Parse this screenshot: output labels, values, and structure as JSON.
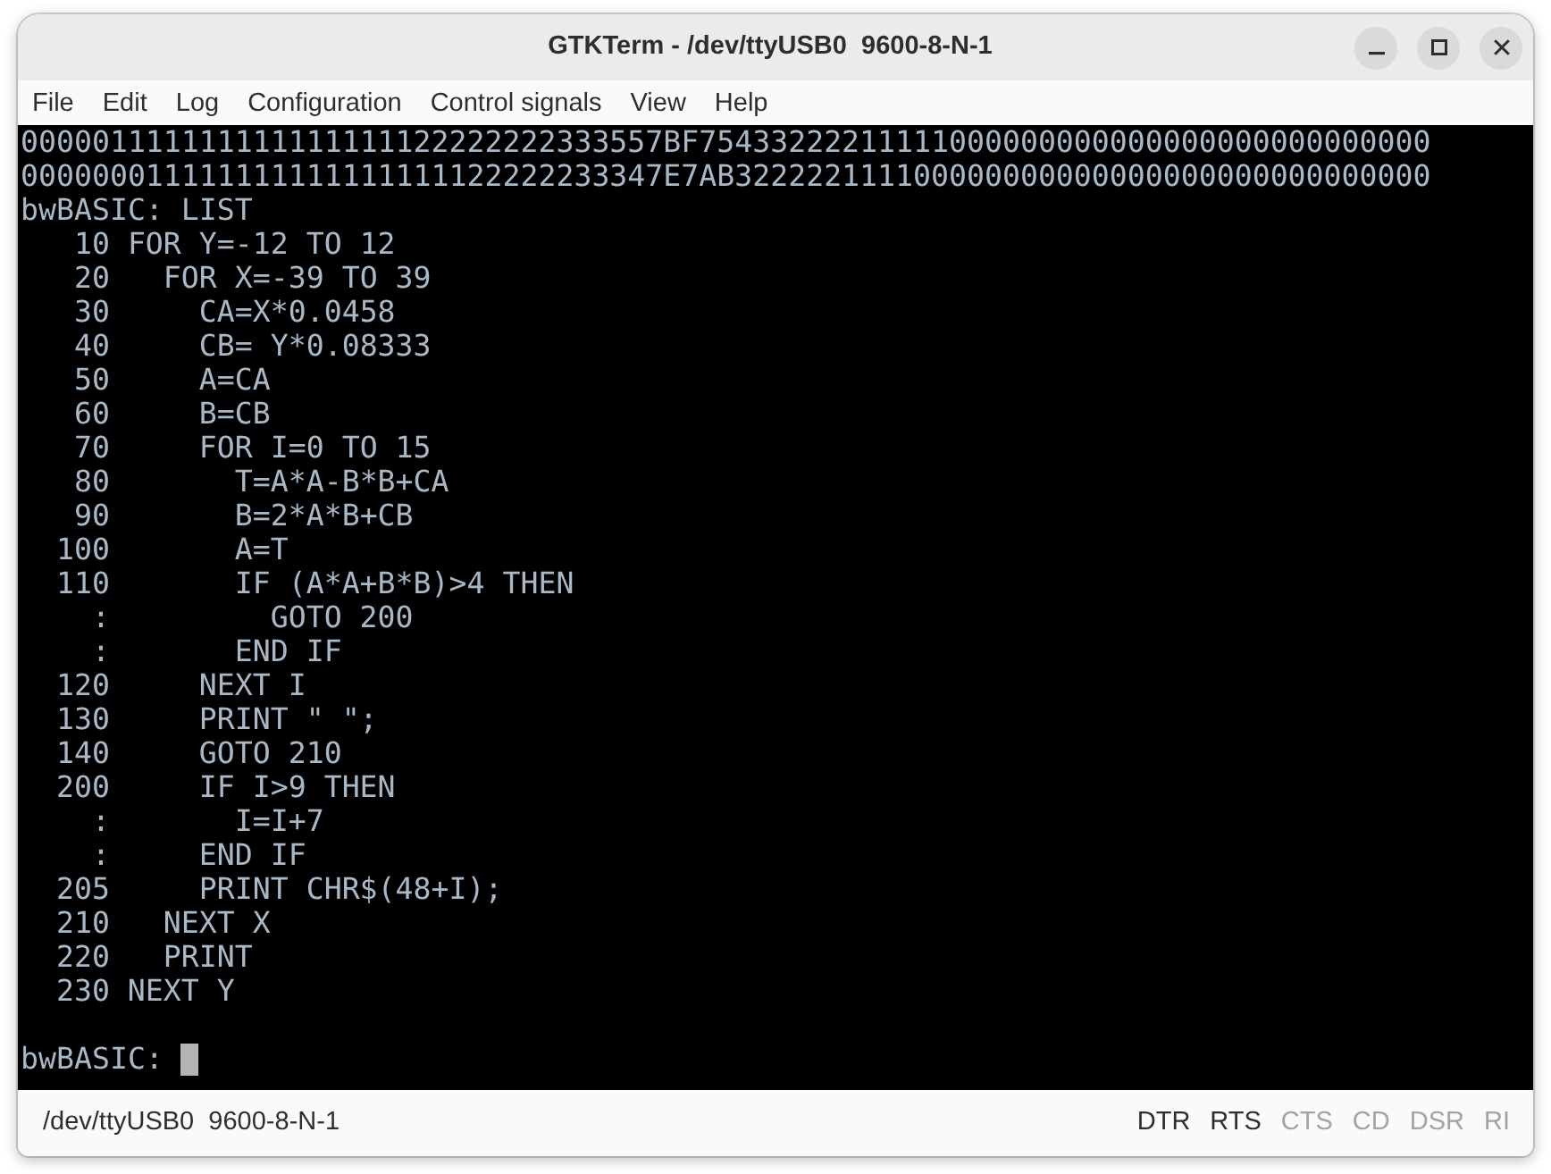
{
  "window": {
    "title": "GTKTerm - /dev/ttyUSB0  9600-8-N-1"
  },
  "menu": [
    "File",
    "Edit",
    "Log",
    "Configuration",
    "Control signals",
    "View",
    "Help"
  ],
  "terminal": {
    "lines": [
      {
        "kind": "text",
        "text": "000001111111111111111122222222333557BF75433222211111000000000000000000000000000"
      },
      {
        "kind": "text",
        "text": "000000011111111111111111122222233347E7AB322222111100000000000000000000000000000"
      },
      {
        "kind": "text",
        "text": "bwBASIC: LIST"
      },
      {
        "kind": "text",
        "text": "   10 FOR Y=-12 TO 12"
      },
      {
        "kind": "text",
        "text": "   20   FOR X=-39 TO 39"
      },
      {
        "kind": "text",
        "text": "   30     CA=X*0.0458"
      },
      {
        "kind": "text",
        "text": "   40     CB= Y*0.08333"
      },
      {
        "kind": "text",
        "text": "   50     A=CA"
      },
      {
        "kind": "text",
        "text": "   60     B=CB"
      },
      {
        "kind": "text",
        "text": "   70     FOR I=0 TO 15"
      },
      {
        "kind": "text",
        "text": "   80       T=A*A-B*B+CA"
      },
      {
        "kind": "text",
        "text": "   90       B=2*A*B+CB"
      },
      {
        "kind": "text",
        "text": "  100       A=T"
      },
      {
        "kind": "text",
        "text": "  110       IF (A*A+B*B)>4 THEN"
      },
      {
        "kind": "text",
        "text": "    :         GOTO 200"
      },
      {
        "kind": "text",
        "text": "    :       END IF"
      },
      {
        "kind": "text",
        "text": "  120     NEXT I"
      },
      {
        "kind": "text",
        "text": "  130     PRINT \" \";"
      },
      {
        "kind": "text",
        "text": "  140     GOTO 210"
      },
      {
        "kind": "text",
        "text": "  200     IF I>9 THEN"
      },
      {
        "kind": "text",
        "text": "    :       I=I+7"
      },
      {
        "kind": "text",
        "text": "    :     END IF"
      },
      {
        "kind": "text",
        "text": "  205     PRINT CHR$(48+I);"
      },
      {
        "kind": "text",
        "text": "  210   NEXT X"
      },
      {
        "kind": "text",
        "text": "  220   PRINT"
      },
      {
        "kind": "text",
        "text": "  230 NEXT Y"
      },
      {
        "kind": "blank"
      },
      {
        "kind": "prompt",
        "text": "bwBASIC:",
        "cursor": true
      }
    ]
  },
  "status_bar": {
    "port": "/dev/ttyUSB0  9600-8-N-1",
    "signals": [
      {
        "label": "DTR",
        "on": true
      },
      {
        "label": "RTS",
        "on": true
      },
      {
        "label": "CTS",
        "on": false
      },
      {
        "label": "CD",
        "on": false
      },
      {
        "label": "DSR",
        "on": false
      },
      {
        "label": "RI",
        "on": false
      }
    ]
  }
}
